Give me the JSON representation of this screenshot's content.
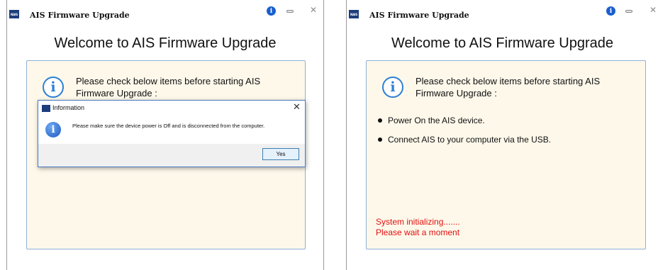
{
  "windows": [
    {
      "title": "AIS Firmware Upgrade",
      "logo_text": "NAIS",
      "heading": "Welcome to AIS Firmware Upgrade",
      "check_text": "Please check below items before starting AIS Firmware Upgrade :",
      "dialog": {
        "title": "Information",
        "message": "Please make sure the device power is Off and is disconnected from the computer.",
        "yes_label": "Yes",
        "close_glyph": "✕",
        "icon": "info-icon"
      }
    },
    {
      "title": "AIS Firmware Upgrade",
      "logo_text": "NAIS",
      "heading": "Welcome to AIS Firmware Upgrade",
      "check_text": "Please check below items before starting AIS Firmware Upgrade :",
      "items": [
        "Power On the AIS device.",
        "Connect AIS to your computer via the USB."
      ],
      "status": [
        "System initializing.......",
        "Please wait a moment"
      ]
    }
  ],
  "colors": {
    "panel_bg": "#fdf8ea",
    "panel_border": "#8fb1d8",
    "status_red": "#e01010",
    "info_blue": "#1a5fd0"
  }
}
